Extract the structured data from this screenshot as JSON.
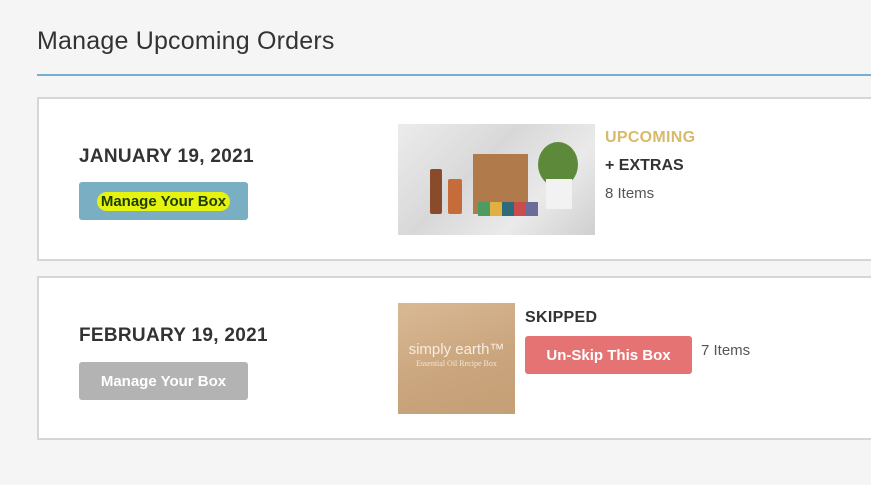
{
  "page": {
    "title": "Manage Upcoming Orders"
  },
  "orders": [
    {
      "date": "JANUARY 19, 2021",
      "manage_label": "Manage Your Box",
      "status": "UPCOMING",
      "extras": "+ EXTRAS",
      "items": "8 Items"
    },
    {
      "date": "FEBRUARY 19, 2021",
      "manage_label": "Manage Your Box",
      "status": "SKIPPED",
      "unskip_label": "Un-Skip This Box",
      "items": "7 Items",
      "thumb_brand": "simply earth™",
      "thumb_sub": "Essential Oil Recipe Box"
    }
  ],
  "colors": {
    "accent_rule": "#7aaed1",
    "manage_active": "#7aaec2",
    "manage_disabled": "#b3b3b3",
    "upcoming_status": "#d9b96a",
    "unskip_button": "#e57373",
    "highlight": "#e6f20f"
  }
}
